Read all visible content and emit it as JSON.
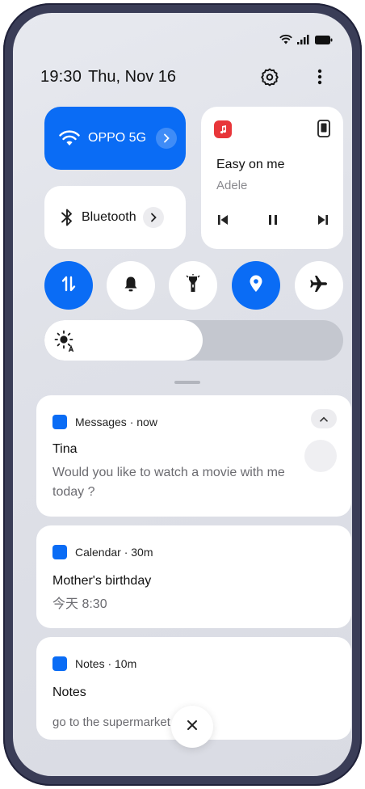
{
  "status": {
    "time": "19:30",
    "date": "Thu, Nov 16"
  },
  "tiles": {
    "wifi_label": "OPPO 5G",
    "bluetooth_label": "Bluetooth"
  },
  "media": {
    "song": "Easy on me",
    "artist": "Adele"
  },
  "toggles": [
    {
      "icon": "mobile-data-icon",
      "on": true
    },
    {
      "icon": "bell-icon",
      "on": false
    },
    {
      "icon": "flashlight-icon",
      "on": false
    },
    {
      "icon": "location-icon",
      "on": true
    },
    {
      "icon": "airplane-icon",
      "on": false
    }
  ],
  "brightness": {
    "level": 0.53
  },
  "notifications": [
    {
      "app": "Messages",
      "time": "now",
      "header": "Messages · now",
      "title": "Tina",
      "body": "Would you like to watch a movie with me today ?"
    },
    {
      "app": "Calendar",
      "time": "30m",
      "header": "Calendar · 30m",
      "title": "Mother's birthday",
      "body": "今天 8:30"
    },
    {
      "app": "Notes",
      "time": "10m",
      "header": "Notes · 10m",
      "title": "Notes",
      "body": "go to the supermarket"
    }
  ],
  "colors": {
    "accent": "#0a6cf5",
    "music_app": "#e8363a",
    "background": "#e2e4ea",
    "frame": "#3a3d57"
  }
}
